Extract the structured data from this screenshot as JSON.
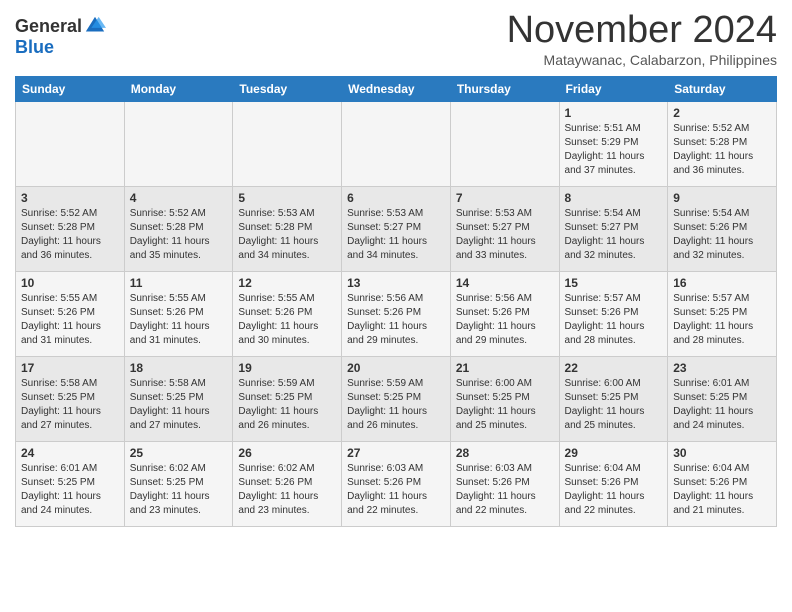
{
  "header": {
    "logo": {
      "general": "General",
      "blue": "Blue"
    },
    "title": "November 2024",
    "location": "Mataywanac, Calabarzon, Philippines"
  },
  "calendar": {
    "days_of_week": [
      "Sunday",
      "Monday",
      "Tuesday",
      "Wednesday",
      "Thursday",
      "Friday",
      "Saturday"
    ],
    "weeks": [
      [
        {
          "day": "",
          "info": ""
        },
        {
          "day": "",
          "info": ""
        },
        {
          "day": "",
          "info": ""
        },
        {
          "day": "",
          "info": ""
        },
        {
          "day": "",
          "info": ""
        },
        {
          "day": "1",
          "info": "Sunrise: 5:51 AM\nSunset: 5:29 PM\nDaylight: 11 hours and 37 minutes."
        },
        {
          "day": "2",
          "info": "Sunrise: 5:52 AM\nSunset: 5:28 PM\nDaylight: 11 hours and 36 minutes."
        }
      ],
      [
        {
          "day": "3",
          "info": "Sunrise: 5:52 AM\nSunset: 5:28 PM\nDaylight: 11 hours and 36 minutes."
        },
        {
          "day": "4",
          "info": "Sunrise: 5:52 AM\nSunset: 5:28 PM\nDaylight: 11 hours and 35 minutes."
        },
        {
          "day": "5",
          "info": "Sunrise: 5:53 AM\nSunset: 5:28 PM\nDaylight: 11 hours and 34 minutes."
        },
        {
          "day": "6",
          "info": "Sunrise: 5:53 AM\nSunset: 5:27 PM\nDaylight: 11 hours and 34 minutes."
        },
        {
          "day": "7",
          "info": "Sunrise: 5:53 AM\nSunset: 5:27 PM\nDaylight: 11 hours and 33 minutes."
        },
        {
          "day": "8",
          "info": "Sunrise: 5:54 AM\nSunset: 5:27 PM\nDaylight: 11 hours and 32 minutes."
        },
        {
          "day": "9",
          "info": "Sunrise: 5:54 AM\nSunset: 5:26 PM\nDaylight: 11 hours and 32 minutes."
        }
      ],
      [
        {
          "day": "10",
          "info": "Sunrise: 5:55 AM\nSunset: 5:26 PM\nDaylight: 11 hours and 31 minutes."
        },
        {
          "day": "11",
          "info": "Sunrise: 5:55 AM\nSunset: 5:26 PM\nDaylight: 11 hours and 31 minutes."
        },
        {
          "day": "12",
          "info": "Sunrise: 5:55 AM\nSunset: 5:26 PM\nDaylight: 11 hours and 30 minutes."
        },
        {
          "day": "13",
          "info": "Sunrise: 5:56 AM\nSunset: 5:26 PM\nDaylight: 11 hours and 29 minutes."
        },
        {
          "day": "14",
          "info": "Sunrise: 5:56 AM\nSunset: 5:26 PM\nDaylight: 11 hours and 29 minutes."
        },
        {
          "day": "15",
          "info": "Sunrise: 5:57 AM\nSunset: 5:26 PM\nDaylight: 11 hours and 28 minutes."
        },
        {
          "day": "16",
          "info": "Sunrise: 5:57 AM\nSunset: 5:25 PM\nDaylight: 11 hours and 28 minutes."
        }
      ],
      [
        {
          "day": "17",
          "info": "Sunrise: 5:58 AM\nSunset: 5:25 PM\nDaylight: 11 hours and 27 minutes."
        },
        {
          "day": "18",
          "info": "Sunrise: 5:58 AM\nSunset: 5:25 PM\nDaylight: 11 hours and 27 minutes."
        },
        {
          "day": "19",
          "info": "Sunrise: 5:59 AM\nSunset: 5:25 PM\nDaylight: 11 hours and 26 minutes."
        },
        {
          "day": "20",
          "info": "Sunrise: 5:59 AM\nSunset: 5:25 PM\nDaylight: 11 hours and 26 minutes."
        },
        {
          "day": "21",
          "info": "Sunrise: 6:00 AM\nSunset: 5:25 PM\nDaylight: 11 hours and 25 minutes."
        },
        {
          "day": "22",
          "info": "Sunrise: 6:00 AM\nSunset: 5:25 PM\nDaylight: 11 hours and 25 minutes."
        },
        {
          "day": "23",
          "info": "Sunrise: 6:01 AM\nSunset: 5:25 PM\nDaylight: 11 hours and 24 minutes."
        }
      ],
      [
        {
          "day": "24",
          "info": "Sunrise: 6:01 AM\nSunset: 5:25 PM\nDaylight: 11 hours and 24 minutes."
        },
        {
          "day": "25",
          "info": "Sunrise: 6:02 AM\nSunset: 5:25 PM\nDaylight: 11 hours and 23 minutes."
        },
        {
          "day": "26",
          "info": "Sunrise: 6:02 AM\nSunset: 5:26 PM\nDaylight: 11 hours and 23 minutes."
        },
        {
          "day": "27",
          "info": "Sunrise: 6:03 AM\nSunset: 5:26 PM\nDaylight: 11 hours and 22 minutes."
        },
        {
          "day": "28",
          "info": "Sunrise: 6:03 AM\nSunset: 5:26 PM\nDaylight: 11 hours and 22 minutes."
        },
        {
          "day": "29",
          "info": "Sunrise: 6:04 AM\nSunset: 5:26 PM\nDaylight: 11 hours and 22 minutes."
        },
        {
          "day": "30",
          "info": "Sunrise: 6:04 AM\nSunset: 5:26 PM\nDaylight: 11 hours and 21 minutes."
        }
      ]
    ]
  }
}
